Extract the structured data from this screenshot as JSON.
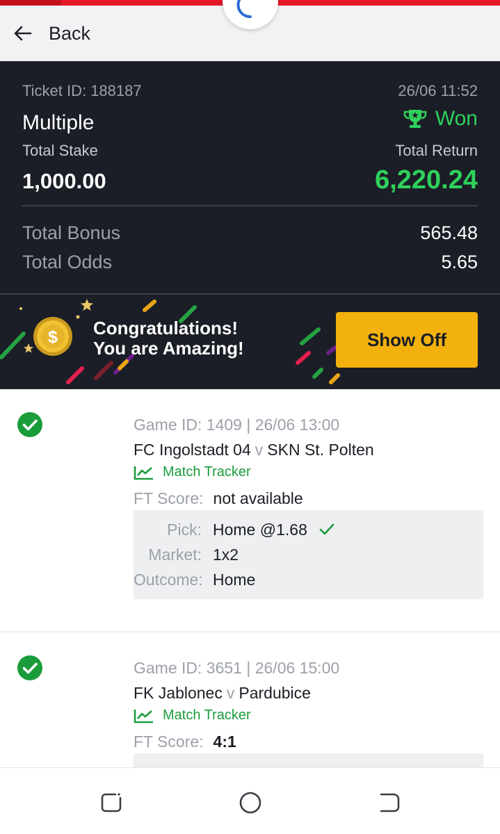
{
  "nav": {
    "back_label": "Back",
    "arrow_icon": "arrow-left-icon"
  },
  "ticket": {
    "id_label": "Ticket ID: 188187",
    "datetime": "26/06 11:52",
    "type": "Multiple",
    "status": "Won",
    "status_icon": "trophy-icon",
    "stake_label": "Total Stake",
    "stake_value": "1,000.00",
    "return_label": "Total Return",
    "return_value": "6,220.24",
    "bonus_label": "Total Bonus",
    "bonus_value": "565.48",
    "odds_label": "Total Odds",
    "odds_value": "5.65"
  },
  "banner": {
    "line1": "Congratulations!",
    "line2": "You are Amazing!",
    "button_label": "Show Off",
    "coin_icon": "dollar-coin-icon"
  },
  "bets": [
    {
      "game_line": "Game ID: 1409 | 26/06 13:00",
      "home": "FC Ingolstadt 04",
      "vs": "v",
      "away": "SKN St. Polten",
      "tracker_label": "Match Tracker",
      "ft_label": "FT Score:",
      "ft_value": "not available",
      "pick_label": "Pick:",
      "pick_value": "Home @1.68",
      "market_label": "Market:",
      "market_value": "1x2",
      "outcome_label": "Outcome:",
      "outcome_value": "Home"
    },
    {
      "game_line": "Game ID: 3651 | 26/06 15:00",
      "home": "FK Jablonec",
      "vs": "v",
      "away": "Pardubice",
      "tracker_label": "Match Tracker",
      "ft_label": "FT Score:",
      "ft_value": "4:1"
    }
  ],
  "colors": {
    "accent_red": "#e41827",
    "win_green": "#2fd15b",
    "tracker_green": "#1a9c3b",
    "dark_panel": "#1b1e26",
    "show_off_yellow": "#f2b10c"
  }
}
